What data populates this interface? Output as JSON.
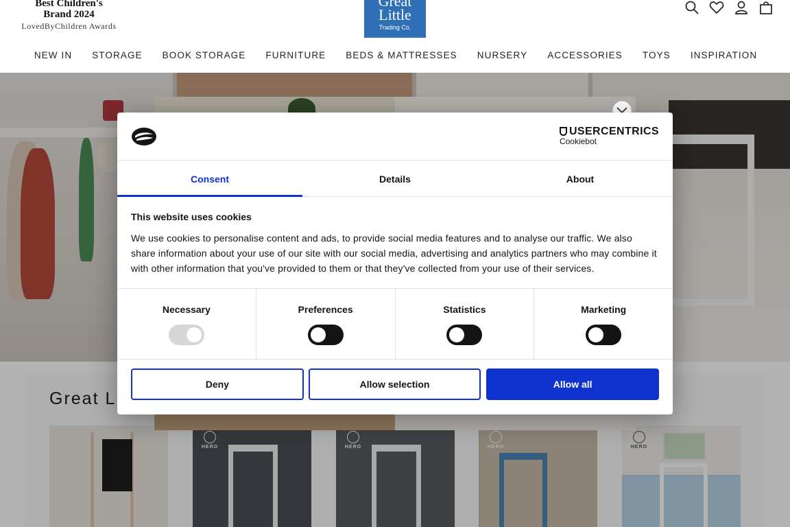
{
  "header": {
    "award": {
      "line1": "Best Children's",
      "line2": "Brand 2024",
      "line3": "LovedByChildren Awards"
    },
    "logo": {
      "line1": "Great",
      "line2": "Little",
      "line3": "Trading Co."
    },
    "icons": [
      "search-icon",
      "heart-icon",
      "account-icon",
      "bag-icon"
    ]
  },
  "nav": {
    "items": [
      "NEW IN",
      "STORAGE",
      "BOOK STORAGE",
      "FURNITURE",
      "BEDS & MATTRESSES",
      "NURSERY",
      "ACCESSORIES",
      "TOYS",
      "INSPIRATION"
    ]
  },
  "section": {
    "title": "Great Lit",
    "badge_text": "HERO"
  },
  "popup": {
    "close_symbol": "✕"
  },
  "cookie": {
    "brand": "USERCENTRICS",
    "brand_sub": "Cookiebot",
    "tabs": [
      "Consent",
      "Details",
      "About"
    ],
    "active_tab": "Consent",
    "title": "This website uses cookies",
    "text": "We use cookies to personalise content and ads, to provide social media features and to analyse our traffic. We also share information about your use of our site with our social media, advertising and analytics partners who may combine it with other information that you've provided to them or that they've collected from your use of their services.",
    "categories": [
      {
        "label": "Necessary",
        "checked": true,
        "disabled": true
      },
      {
        "label": "Preferences",
        "checked": false,
        "disabled": false
      },
      {
        "label": "Statistics",
        "checked": false,
        "disabled": false
      },
      {
        "label": "Marketing",
        "checked": false,
        "disabled": false
      }
    ],
    "buttons": {
      "deny": "Deny",
      "allow_selection": "Allow selection",
      "allow_all": "Allow all"
    },
    "accent_color": "#1032cf"
  }
}
